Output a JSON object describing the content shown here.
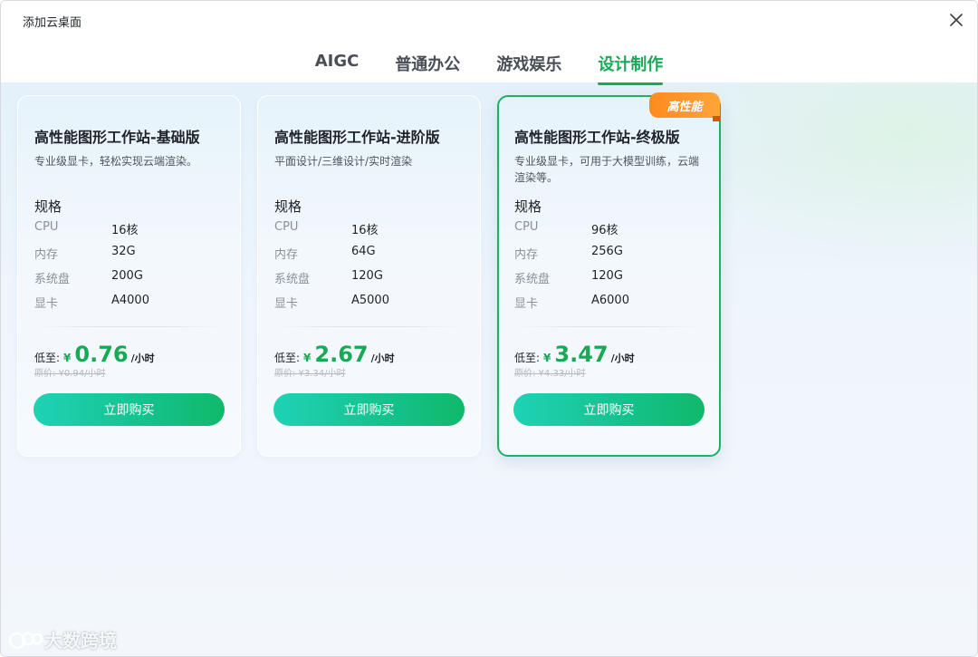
{
  "window": {
    "title": "添加云桌面"
  },
  "tabs": [
    {
      "label": "AIGC",
      "active": false
    },
    {
      "label": "普通办公",
      "active": false
    },
    {
      "label": "游戏娱乐",
      "active": false
    },
    {
      "label": "设计制作",
      "active": true
    }
  ],
  "spec_heading": "规格",
  "spec_labels": {
    "cpu": "CPU",
    "memory": "内存",
    "disk": "系统盘",
    "gpu": "显卡"
  },
  "price_prefix": "低至:",
  "currency": "¥",
  "price_unit": "/小时",
  "buy_label": "立即购买",
  "cards": [
    {
      "title": "高性能图形工作站-基础版",
      "desc": "专业级显卡，轻松实现云端渲染。",
      "cpu": "16核",
      "memory": "32G",
      "disk": "200G",
      "gpu": "A4000",
      "price": "0.76",
      "orig_price": "原价: ¥0.94/小时"
    },
    {
      "title": "高性能图形工作站-进阶版",
      "desc": "平面设计/三维设计/实时渲染",
      "cpu": "16核",
      "memory": "64G",
      "disk": "120G",
      "gpu": "A5000",
      "price": "2.67",
      "orig_price": "原价: ¥3.34/小时"
    },
    {
      "title": "高性能图形工作站-终极版",
      "desc": "专业级显卡，可用于大模型训练，云端渲染等。",
      "cpu": "96核",
      "memory": "256G",
      "disk": "120G",
      "gpu": "A6000",
      "price": "3.47",
      "orig_price": "原价: ¥4.33/小时",
      "badge": "高性能"
    }
  ],
  "watermark": "大数跨境",
  "colors": {
    "accent": "#18a957",
    "badge": "#ff8a1e",
    "button_start": "#1ed2b5",
    "button_end": "#10b96a"
  }
}
